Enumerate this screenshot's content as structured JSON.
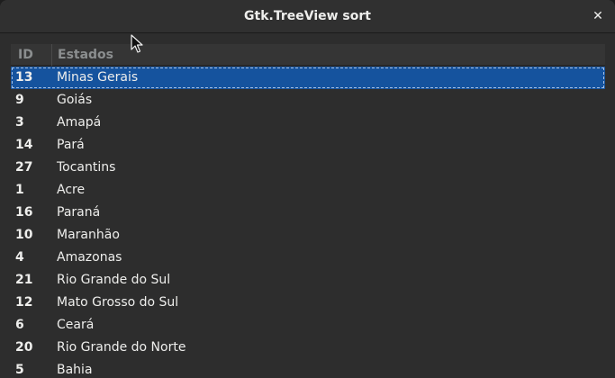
{
  "window": {
    "title": "Gtk.TreeView sort",
    "close_glyph": "✕"
  },
  "tree": {
    "columns": {
      "id": "ID",
      "estado": "Estados"
    },
    "selected_index": 0,
    "rows": [
      {
        "id": "13",
        "estado": "Minas Gerais"
      },
      {
        "id": "9",
        "estado": "Goiás"
      },
      {
        "id": "3",
        "estado": "Amapá"
      },
      {
        "id": "14",
        "estado": "Pará"
      },
      {
        "id": "27",
        "estado": "Tocantins"
      },
      {
        "id": "1",
        "estado": "Acre"
      },
      {
        "id": "16",
        "estado": "Paraná"
      },
      {
        "id": "10",
        "estado": "Maranhão"
      },
      {
        "id": "4",
        "estado": "Amazonas"
      },
      {
        "id": "21",
        "estado": "Rio Grande do Sul"
      },
      {
        "id": "12",
        "estado": "Mato Grosso do Sul"
      },
      {
        "id": "6",
        "estado": "Ceará"
      },
      {
        "id": "20",
        "estado": "Rio Grande do Norte"
      },
      {
        "id": "5",
        "estado": "Bahia"
      }
    ]
  },
  "icons": {
    "cursor": "mouse-pointer-icon",
    "close": "close-icon"
  },
  "colors": {
    "selection": "#15539e",
    "background": "#2d2d2d",
    "text": "#eeeeec",
    "header_text": "#8b8e8f"
  }
}
